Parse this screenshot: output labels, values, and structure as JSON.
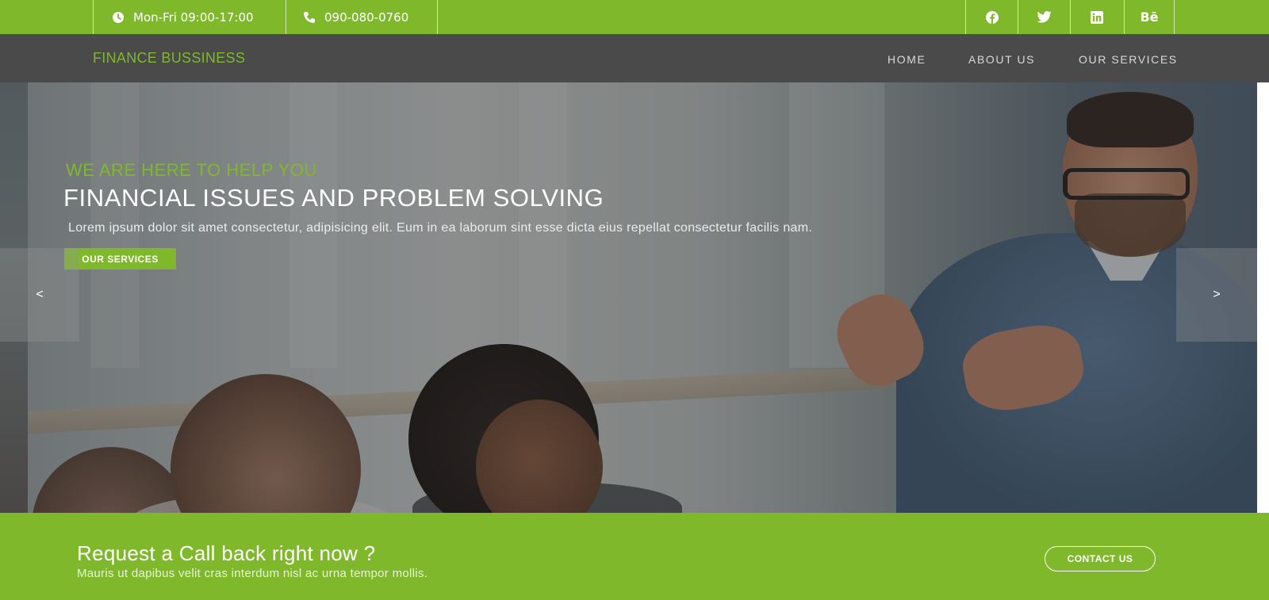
{
  "topbar": {
    "hours": "Mon-Fri  09:00-17:00",
    "phone": "090-080-0760",
    "icons": {
      "clock": "clock-icon",
      "phone": "phone-icon"
    },
    "social": [
      {
        "name": "facebook-icon",
        "glyph": "f"
      },
      {
        "name": "twitter-icon",
        "glyph": "🐦"
      },
      {
        "name": "linkedin-icon",
        "glyph": "in"
      },
      {
        "name": "behance-icon",
        "glyph": "Bē"
      }
    ]
  },
  "nav": {
    "brand": "FINANCE BUSSINESS",
    "items": [
      "HOME",
      "ABOUT US",
      "OUR SERVICES"
    ]
  },
  "hero": {
    "kicker": "WE ARE HERE TO HELP YOU",
    "headline": "FINANCIAL ISSUES AND PROBLEM SOLVING",
    "text": "Lorem ipsum dolor sit amet consectetur, adipisicing elit. Eum in ea laborum sint esse dicta eius repellat consectetur facilis nam.",
    "button": "OUR SERVICES",
    "prev": "<",
    "next": ">"
  },
  "callback": {
    "title": "Request a Call back right now ?",
    "subtitle": "Mauris ut dapibus velit cras interdum nisl ac urna tempor mollis.",
    "button": "CONTACT US"
  },
  "colors": {
    "accent": "#7fb82b",
    "nav_bg": "#4a4a4a"
  }
}
